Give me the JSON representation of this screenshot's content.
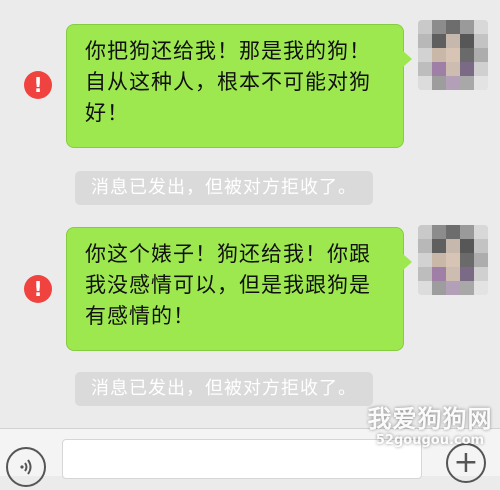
{
  "messages": [
    {
      "text": "你把狗还给我！那是我的狗！自从这种人，根本不可能对狗好！",
      "error_mark": "!"
    },
    {
      "text": "你这个婊子！狗还给我！你跟我没感情可以，但是我跟狗是有感情的！",
      "error_mark": "!"
    }
  ],
  "notices": [
    "消息已发出，但被对方拒收了。",
    "消息已发出，但被对方拒收了。"
  ],
  "input_bar": {
    "voice_icon": "voice-icon",
    "plus_icon": "plus-icon",
    "value": ""
  },
  "watermark": {
    "name": "我爱狗狗网",
    "url": "52gougou.com"
  },
  "colors": {
    "bubble": "#9ee84f",
    "error": "#f0433f",
    "notice_bg": "#dadada",
    "background": "#ebebeb"
  }
}
